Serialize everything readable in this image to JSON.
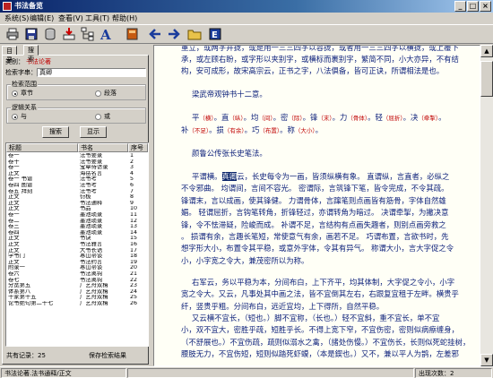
{
  "window": {
    "title": "书法备览"
  },
  "menu": [
    "系统(S)",
    "编辑(E)",
    "查看(V)",
    "工具(T)",
    "帮助(H)"
  ],
  "toolbar": [
    {
      "name": "printer-icon"
    },
    {
      "name": "save-icon"
    },
    {
      "name": "database-icon"
    },
    {
      "name": "download-icon"
    },
    {
      "name": "tree-icon"
    },
    {
      "name": "font-icon"
    },
    {
      "name": "book-icon"
    },
    {
      "name": "back-arrow-icon"
    },
    {
      "name": "forward-arrow-icon"
    },
    {
      "name": "folder-icon"
    },
    {
      "name": "export-icon"
    }
  ],
  "left": {
    "tabs": [
      "目录",
      "搜索"
    ],
    "category_label": "类别：",
    "category_value": "书法论著",
    "keyword_label": "检索字串：",
    "keyword_value": "真卿",
    "range": {
      "label": "检索范围",
      "opt1": "章节",
      "opt2": "段落"
    },
    "logic": {
      "label": "逻辑关系",
      "opt1": "与",
      "opt2": "或"
    },
    "search_btn": "搜索",
    "show_btn": "显示",
    "columns": [
      "标题",
      "书名",
      "序号"
    ],
    "rows": [
      [
        "卷一",
        "法书要录",
        "1"
      ],
      [
        "卷十",
        "法书要录",
        "2"
      ],
      [
        "卷一",
        "宝章待访录",
        "3"
      ],
      [
        "正文",
        "海岳名言",
        "4"
      ],
      [
        "卷一  书谱",
        "法书考",
        "5"
      ],
      [
        "卷四  图谱",
        "法书考",
        "6"
      ],
      [
        "卷五  拜刻",
        "法书考",
        "7"
      ],
      [
        "正文",
        "衍极",
        "8"
      ],
      [
        "正文",
        "书法通释",
        "9"
      ],
      [
        "正文",
        "书品",
        "10"
      ],
      [
        "卷一",
        "墨池琐录",
        "11"
      ],
      [
        "卷二",
        "墨池琐录",
        "12"
      ],
      [
        "卷三",
        "墨池琐录",
        "13"
      ],
      [
        "卷四",
        "墨池琐录",
        "14"
      ],
      [
        "正文",
        "书诀",
        "15"
      ],
      [
        "正文",
        "书法雅言",
        "16"
      ],
      [
        "正文",
        "大书长语",
        "17"
      ],
      [
        "学书门",
        "寒山帚谈",
        "18"
      ],
      [
        "正文",
        "书法约言",
        "19"
      ],
      [
        "附录一",
        "寒山帚谈",
        "20"
      ],
      [
        "卷六",
        "书法离钩",
        "21"
      ],
      [
        "卷七",
        "书法离钩",
        "22"
      ],
      [
        "分宽第五",
        "广艺舟双楫",
        "23"
      ],
      [
        "体系第八",
        "广艺舟双楫",
        "24"
      ],
      [
        "十家第十五",
        "广艺舟双楫",
        "25"
      ],
      [
        "论书绝句第二十七",
        "广艺舟双楫",
        "26"
      ]
    ],
    "total_label": "共有记录：25",
    "save_label": "保存检索结果"
  },
  "doc": {
    "lines": [
      "重立，或两字并拢，或是用一三三四字以容拢，或者用一三三四字以横拢，或上覆下",
      "承，或左顾右盼，或字形以夹别字，或横标而裹别字，繁简不同，小大亦异，不有结",
      "构，安可成形，故宋高宗云，正书之字，八法俱备，皆可正诀，所谓相法是也。"
    ],
    "heading1": "梁武帝观钟书十二意。",
    "formula": [
      {
        "t": "平"
      },
      {
        "n": "（横）"
      },
      {
        "t": "。直"
      },
      {
        "n": "（纵）"
      },
      {
        "t": "。均"
      },
      {
        "n": "（间）"
      },
      {
        "t": "。密"
      },
      {
        "n": "（际）"
      },
      {
        "t": "。锋"
      },
      {
        "n": "（末）"
      },
      {
        "t": "。力"
      },
      {
        "n": "（骨体）"
      },
      {
        "t": "。轻"
      },
      {
        "n": "（屈折）"
      },
      {
        "t": "。决"
      },
      {
        "n": "（牵掣）"
      },
      {
        "t": "。"
      }
    ],
    "formula2": [
      {
        "t": "补"
      },
      {
        "n": "（不足）"
      },
      {
        "t": "。损"
      },
      {
        "n": "（有余）"
      },
      {
        "t": "。巧"
      },
      {
        "n": "（布置）"
      },
      {
        "t": "。称"
      },
      {
        "n": "（大小）"
      },
      {
        "t": "。"
      }
    ],
    "heading2": "颜鲁公传张长史笔法。",
    "para1_pre": "平谓横。",
    "para1_hl": "真卿",
    "para1_post": "云，长史每令为一画，皆须纵横有象。 直谓纵，言直者，必纵之",
    "para1": [
      "不令邪曲。 均谓间，言间不容光。 密谓际，言筑锋下笔，皆令完成，不令其疏。",
      "锋谓末，言以成画，使其锋健。 力谓骨体，言蹿笔则点画皆有筋骨，字体自然雄",
      "媚。 轻谓屈折，言钩笔转角，折锋轻过，亦谓转角为暗过。 决谓牵掣，为撇决意",
      "锋，令不怯滞疑，险峻而成。 补谓不足，言结构有点画失趣者，则别点画旁救之",
      "。 损谓有余，言趣长笔短，常使意气有余，画若不足。 巧谓布置，言欲书时，先",
      "想字形大小，布置令其平稳，或意外字体，令其有异气。 称谓大小，言大字促之令",
      "小，小字宽之令大，兼茂密所以为称。"
    ],
    "para2": [
      "右军云，务以平稳为本，分间布白，上下齐平，均其体制，大字促之令小，小字",
      "宽之令大。又云，凡事处其中画之法，皆不宜倒其左右，右跟复宜租于左畔。横贵乎",
      "纤，竖贵乎粗。分间布白，远近宜均，上下得所，自然平稳。"
    ],
    "para3": [
      "又云横不宜长，（短也。）脚不宜称，（长也。）轻不宜斜，重不宜长，单不宜",
      "小，双不宜大，密胜乎疏，短胜乎长。不得上宽下窄，不宜伤密，密则似病瘵缠身，",
      "（不舒展也。）不宜伤疏，疏则似溺水之禽，（諸处伤慢。）不宜伤长，长则似死蛇挂树，",
      "腰肢无力，不宜伤短，短则似踏死虾蟆，（本是鍥也。）又不，兼以平人为鹊，左差邪"
    ]
  },
  "status": {
    "left": "书法论著.法书通释/正文",
    "right": "出现次数：2"
  }
}
